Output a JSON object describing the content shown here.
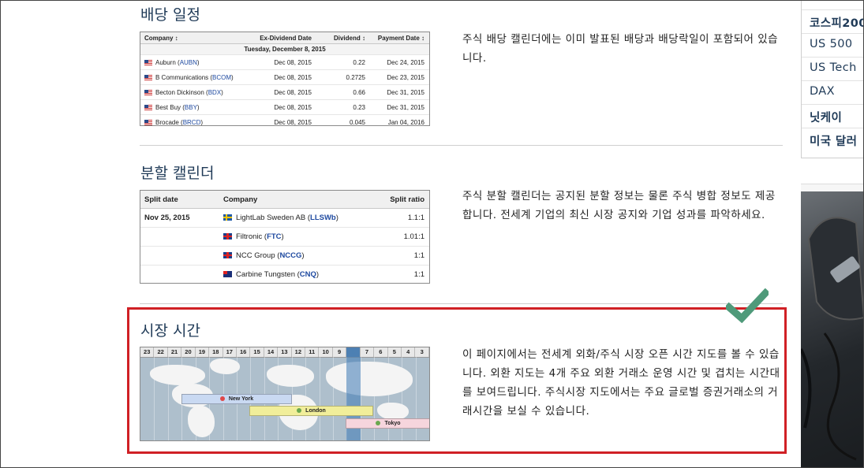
{
  "sections": {
    "dividend": {
      "title": "배당 일정",
      "description": "주식 배당 캘린더에는 이미 발표된 배당과 배당락일이 포함되어 있습니다.",
      "table": {
        "headers": {
          "company": "Company ↕",
          "exdate": "Ex-Dividend Date",
          "dividend": "Dividend ↕",
          "payment": "Payment Date ↕"
        },
        "date_row": "Tuesday, December 8, 2015",
        "rows": [
          {
            "name": "Auburn (",
            "ticker": "AUBN",
            "close": ")",
            "exdate": "Dec 08, 2015",
            "dividend": "0.22",
            "payment": "Dec 24, 2015"
          },
          {
            "name": "B Communications (",
            "ticker": "BCOM",
            "close": ")",
            "exdate": "Dec 08, 2015",
            "dividend": "0.2725",
            "payment": "Dec 23, 2015"
          },
          {
            "name": "Becton Dickinson (",
            "ticker": "BDX",
            "close": ")",
            "exdate": "Dec 08, 2015",
            "dividend": "0.66",
            "payment": "Dec 31, 2015"
          },
          {
            "name": "Best Buy (",
            "ticker": "BBY",
            "close": ")",
            "exdate": "Dec 08, 2015",
            "dividend": "0.23",
            "payment": "Dec 31, 2015"
          },
          {
            "name": "Brocade (",
            "ticker": "BRCD",
            "close": ")",
            "exdate": "Dec 08, 2015",
            "dividend": "0.045",
            "payment": "Jan 04, 2016"
          }
        ]
      }
    },
    "split": {
      "title": "분할 캘린더",
      "description": "주식 분할 캘린더는 공지된 분할 정보는 물론 주식 병합 정보도 제공합니다. 전세계 기업의 최신 시장 공지와 기업 성과를 파악하세요.",
      "table": {
        "headers": {
          "date": "Split date",
          "company": "Company",
          "ratio": "Split ratio"
        },
        "rows": [
          {
            "date": "Nov 25, 2015",
            "flag": "sweden-flag-icon",
            "name": "LightLab Sweden AB (",
            "ticker": "LLSWb",
            "close": ")",
            "ratio": "1.1:1"
          },
          {
            "date": "",
            "flag": "uk-flag-icon",
            "name": "Filtronic (",
            "ticker": "FTC",
            "close": ")",
            "ratio": "1.01:1"
          },
          {
            "date": "",
            "flag": "uk-flag-icon",
            "name": "NCC Group (",
            "ticker": "NCCG",
            "close": ")",
            "ratio": "1:1"
          },
          {
            "date": "",
            "flag": "australia-flag-icon",
            "name": "Carbine Tungsten (",
            "ticker": "CNQ",
            "close": ")",
            "ratio": "1:1"
          }
        ]
      }
    },
    "market_hours": {
      "title": "시장 시간",
      "description": "이 페이지에서는 전세계 외화/주식 시장 오픈 시간 지도를 볼 수 있습니다. 외환 지도는 4개 주요 외환 거래소 운영 시간 및 겹치는 시간대를 보여드립니다. 주식시장 지도에서는 주요 글로벌 증권거래소의 거래시간을 보실 수 있습니다.",
      "hours": [
        "23",
        "22",
        "21",
        "20",
        "19",
        "18",
        "17",
        "16",
        "15",
        "14",
        "13",
        "12",
        "11",
        "10",
        "9",
        "8",
        "7",
        "6",
        "5",
        "4",
        "3"
      ],
      "highlighted_hour_index": 15,
      "markets": [
        {
          "name": "New York",
          "color": "#c9d9f2",
          "dot": "#e04848"
        },
        {
          "name": "London",
          "color": "#f1ee9a",
          "dot": "#6aa84f"
        },
        {
          "name": "Tokyo",
          "color": "#f6d5dd",
          "dot": "#6aa84f"
        }
      ]
    }
  },
  "sidebar": {
    "items": [
      "코스피200",
      "US 500",
      "US Tech",
      "DAX",
      "닛케이",
      "미국 달러"
    ]
  },
  "colors": {
    "highlight_border": "#d02025",
    "checkmark": "#4f9a7a",
    "title": "#1f3a57",
    "ticker": "#1f4aa0"
  }
}
